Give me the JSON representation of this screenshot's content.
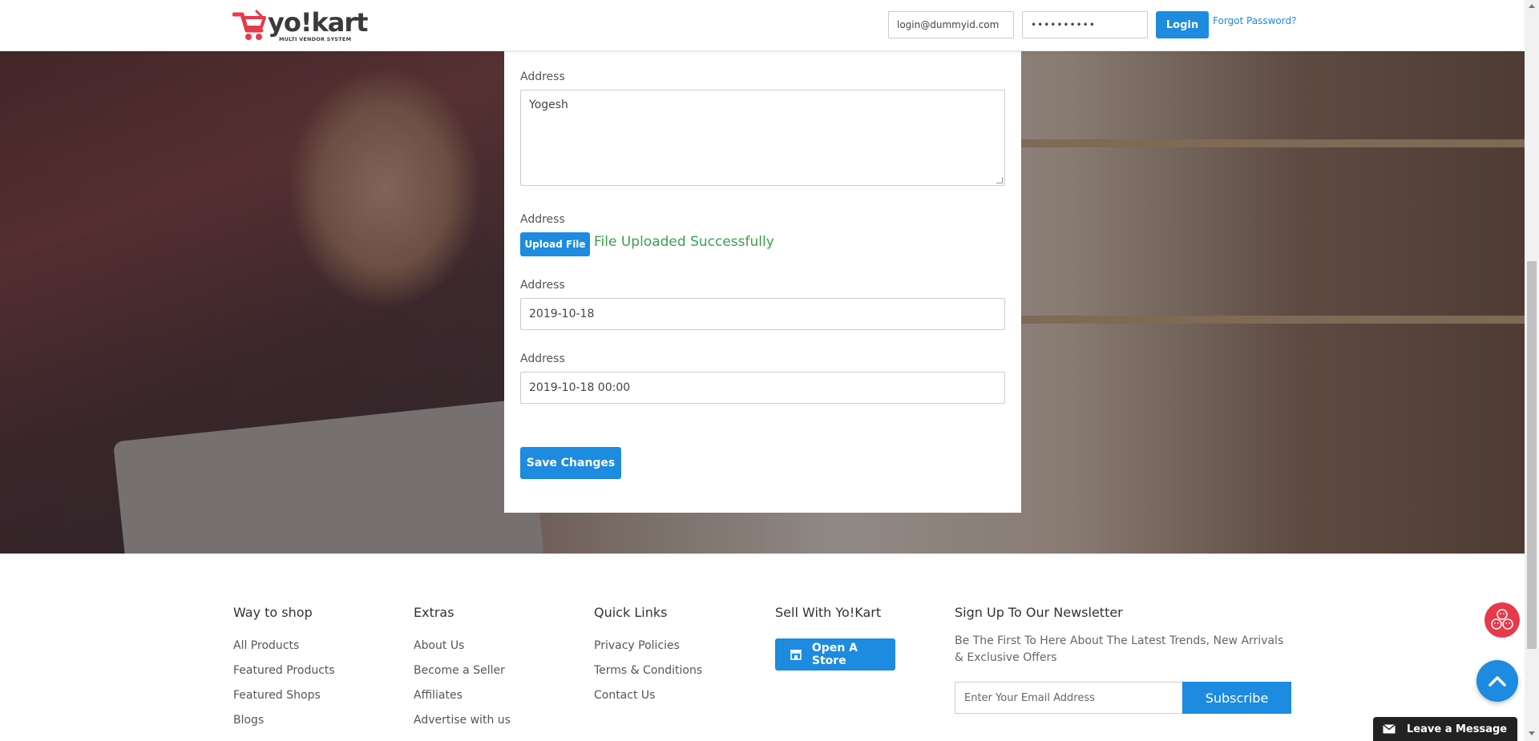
{
  "brand": {
    "name": "yo!kart",
    "tagline": "MULTI VENDOR SYSTEM",
    "accent_color": "#e8394a"
  },
  "header": {
    "email_value": "login@dummyid.com",
    "password_value": "••••••••••",
    "login_label": "Login",
    "forgot_label": "Forgot Password?"
  },
  "form": {
    "fields": [
      {
        "label": "Address",
        "type": "textarea",
        "value": "Yogesh"
      },
      {
        "label": "Address",
        "type": "file",
        "button_label": "Upload File",
        "status": "File Uploaded Successfully"
      },
      {
        "label": "Address",
        "type": "date",
        "value": "2019-10-18"
      },
      {
        "label": "Address",
        "type": "datetime",
        "value": "2019-10-18 00:00"
      }
    ],
    "save_label": "Save Changes"
  },
  "footer": {
    "columns": [
      {
        "title": "Way to shop",
        "links": [
          "All Products",
          "Featured Products",
          "Featured Shops",
          "Blogs"
        ]
      },
      {
        "title": "Extras",
        "links": [
          "About Us",
          "Become a Seller",
          "Affiliates",
          "Advertise with us"
        ]
      },
      {
        "title": "Quick Links",
        "links": [
          "Privacy Policies",
          "Terms & Conditions",
          "Contact Us"
        ]
      }
    ],
    "sell": {
      "title": "Sell With Yo!Kart",
      "button_label": "Open A Store"
    },
    "newsletter": {
      "title": "Sign Up To Our Newsletter",
      "text": "Be The First To Here About The Latest Trends, New Arrivals & Exclusive Offers",
      "placeholder": "Enter Your Email Address",
      "button_label": "Subscribe"
    }
  },
  "widgets": {
    "leave_message_label": "Leave a Message"
  },
  "colors": {
    "primary": "#1c8be0",
    "success": "#3aa14b"
  }
}
